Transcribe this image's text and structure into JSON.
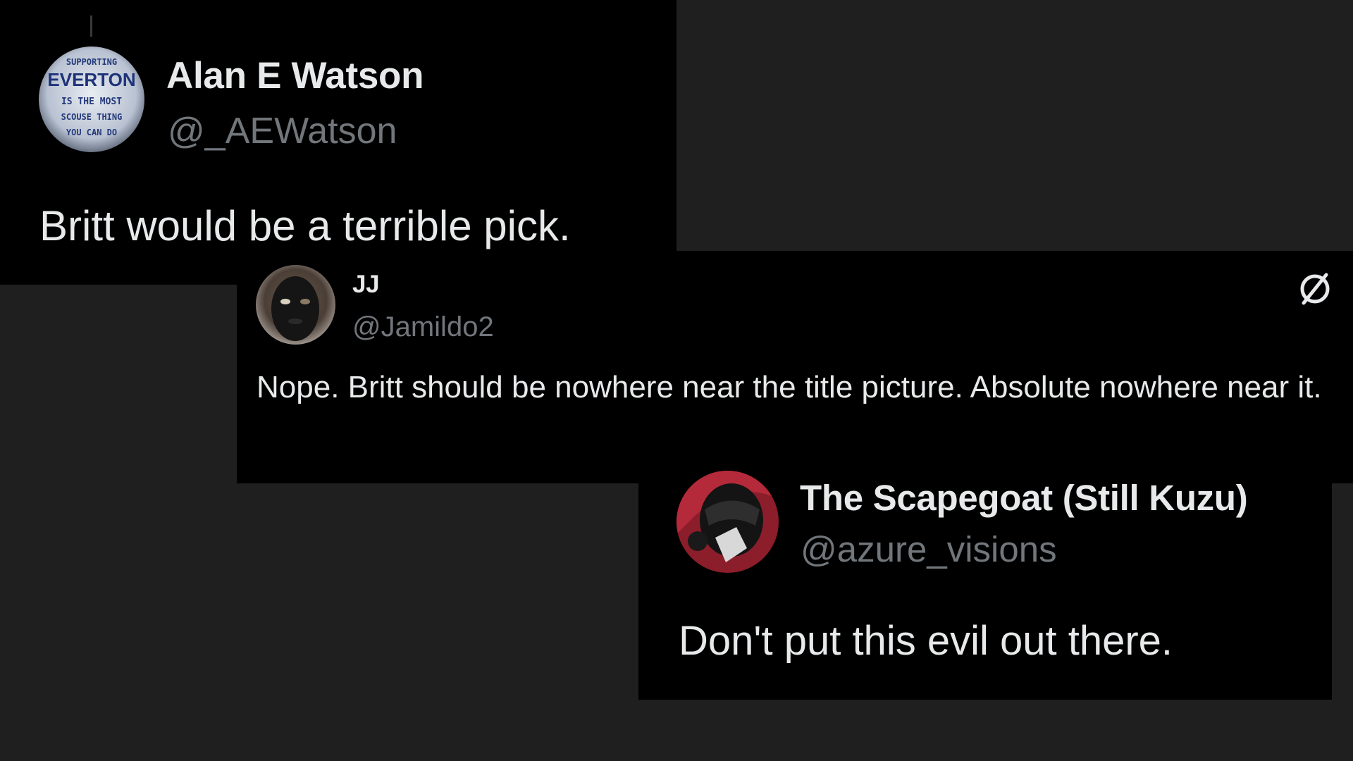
{
  "tweets": [
    {
      "display_name": "Alan E Watson",
      "handle": "@_AEWatson",
      "text": "Britt would be a terrible pick.",
      "avatar": {
        "icon": "everton-sign-avatar",
        "sign_lines": [
          "SUPPORTING",
          "EVERTON",
          "IS THE MOST",
          "SCOUSE THING",
          "YOU CAN DO"
        ]
      }
    },
    {
      "display_name": "JJ",
      "handle": "@Jamildo2",
      "text": "Nope. Britt should be nowhere near the title picture. Absolute nowhere near it.",
      "avatar": {
        "icon": "masked-face-avatar"
      },
      "menu_icon": "no-symbol-icon"
    },
    {
      "display_name": "The Scapegoat (Still Kuzu)",
      "handle": "@azure_visions",
      "text": "Don't put this evil out there.",
      "avatar": {
        "icon": "red-helmet-avatar"
      }
    }
  ],
  "colors": {
    "page_background": "#1f1f1f",
    "card_background": "#000000",
    "primary_text": "#e7e9ea",
    "secondary_text": "#71767b"
  }
}
